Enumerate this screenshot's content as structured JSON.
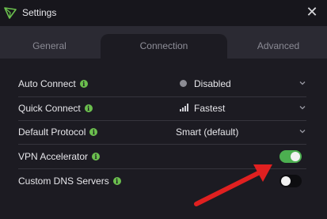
{
  "window": {
    "title": "Settings",
    "close_glyph": "✕",
    "logo_icon": "protonvpn-triangle-logo",
    "brand_color": "#6bbf4e"
  },
  "tabs": [
    {
      "label": "General",
      "active": false
    },
    {
      "label": "Connection",
      "active": true
    },
    {
      "label": "Advanced",
      "active": false
    }
  ],
  "settings": {
    "auto_connect": {
      "label": "Auto Connect",
      "value": "Disabled",
      "icon": "status-dot-icon"
    },
    "quick_connect": {
      "label": "Quick Connect",
      "value": "Fastest",
      "icon": "signal-bars-icon"
    },
    "default_protocol": {
      "label": "Default Protocol",
      "value": "Smart (default)"
    },
    "vpn_accelerator": {
      "label": "VPN Accelerator",
      "enabled": true
    },
    "custom_dns": {
      "label": "Custom DNS Servers",
      "enabled": false
    }
  },
  "info_glyph": "i",
  "colors": {
    "toggle_on": "#4caf50",
    "toggle_off": "#0d0d10",
    "annotation_arrow": "#e02020"
  }
}
